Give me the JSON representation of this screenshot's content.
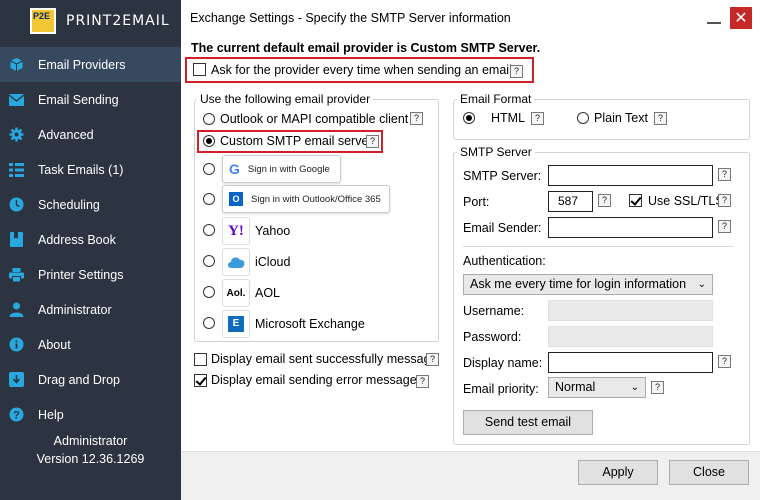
{
  "app": {
    "logo_badge": "P2E",
    "logo_text": "PRINT2EMAIL"
  },
  "sidebar": {
    "items": [
      {
        "label": "Email Providers",
        "icon": "cube-icon"
      },
      {
        "label": "Email Sending",
        "icon": "envelope-icon"
      },
      {
        "label": "Advanced",
        "icon": "gear-icon"
      },
      {
        "label": "Task Emails (1)",
        "icon": "tasks-icon"
      },
      {
        "label": "Scheduling",
        "icon": "clock-icon"
      },
      {
        "label": "Address Book",
        "icon": "book-icon"
      },
      {
        "label": "Printer Settings",
        "icon": "printer-icon"
      },
      {
        "label": "Administrator",
        "icon": "user-icon"
      },
      {
        "label": "About",
        "icon": "info-icon"
      },
      {
        "label": "Drag and Drop",
        "icon": "download-icon"
      },
      {
        "label": "Help",
        "icon": "question-icon"
      }
    ],
    "footer_user": "Administrator",
    "footer_version": "Version 12.36.1269"
  },
  "window": {
    "title": "Exchange Settings - Specify the SMTP Server information",
    "close_glyph": "✕"
  },
  "main": {
    "headline": "The current default email provider is Custom SMTP Server.",
    "ask_provider_label": "Ask for the provider every time when sending an email",
    "provider_group_title": "Use the following email provider",
    "providers": {
      "outlook_mapi": "Outlook or MAPI compatible client",
      "custom_smtp": "Custom SMTP email server",
      "google": "Sign in with Google",
      "outlook365": "Sign in with Outlook/Office 365",
      "yahoo": "Yahoo",
      "icloud": "iCloud",
      "aol": "AOL",
      "exchange": "Microsoft Exchange"
    },
    "display_success_label": "Display email sent successfully message",
    "display_error_label": "Display email sending error messages",
    "email_format": {
      "title": "Email Format",
      "html_label": "HTML",
      "plain_label": "Plain Text"
    },
    "smtp": {
      "title": "SMTP Server",
      "server_label": "SMTP Server:",
      "server_value": "",
      "port_label": "Port:",
      "port_value": "587",
      "ssl_label": "Use SSL/TLS",
      "sender_label": "Email Sender:",
      "sender_value": "",
      "auth_label": "Authentication:",
      "auth_value": "Ask me every time for login information",
      "username_label": "Username:",
      "password_label": "Password:",
      "display_name_label": "Display name:",
      "display_name_value": "",
      "priority_label": "Email priority:",
      "priority_value": "Normal",
      "send_test_label": "Send test email"
    },
    "help_glyph": "?",
    "apply_label": "Apply",
    "close_label": "Close"
  },
  "colors": {
    "sidebar_bg": "#2b3440",
    "sidebar_active": "#36495f",
    "highlight_red": "#d1202a",
    "icon_blue": "#29a8e0"
  }
}
